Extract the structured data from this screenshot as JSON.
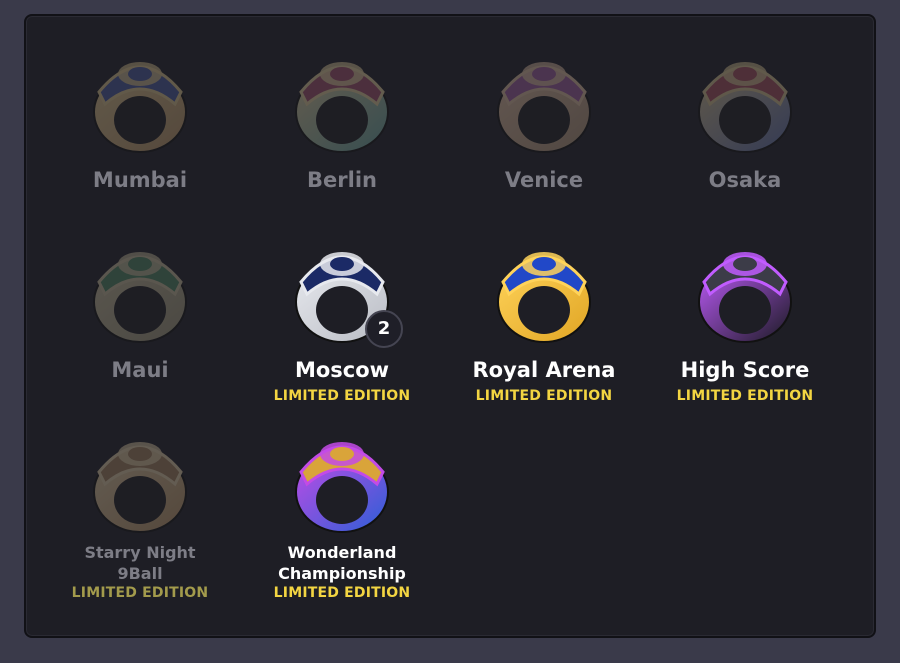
{
  "rings": [
    {
      "id": "mumbai",
      "name": "Mumbai",
      "locked": true,
      "limited": "",
      "badge": "",
      "colors": {
        "band": "#c98a3a",
        "top": "#3b53c8",
        "accent": "#e0b95a"
      }
    },
    {
      "id": "berlin",
      "name": "Berlin",
      "locked": true,
      "limited": "",
      "badge": "",
      "colors": {
        "band": "#3aa7a0",
        "top": "#c63e6b",
        "accent": "#e4c06a"
      }
    },
    {
      "id": "venice",
      "name": "Venice",
      "locked": true,
      "limited": "",
      "badge": "",
      "colors": {
        "band": "#b4875a",
        "top": "#b84ab7",
        "accent": "#e8b07a"
      }
    },
    {
      "id": "osaka",
      "name": "Osaka",
      "locked": true,
      "limited": "",
      "badge": "",
      "colors": {
        "band": "#4a6ad0",
        "top": "#d03e55",
        "accent": "#d9b860"
      }
    },
    {
      "id": "maui",
      "name": "Maui",
      "locked": true,
      "limited": "",
      "badge": "",
      "colors": {
        "band": "#9a8e5e",
        "top": "#2f8a4a",
        "accent": "#c4b278"
      }
    },
    {
      "id": "moscow",
      "name": "Moscow",
      "locked": false,
      "limited": "LIMITED EDITION",
      "badge": "2",
      "colors": {
        "band": "#b9bcc4",
        "top": "#1b2a66",
        "accent": "#e7e9ee"
      }
    },
    {
      "id": "royal-arena",
      "name": "Royal Arena",
      "locked": false,
      "limited": "LIMITED EDITION",
      "badge": "",
      "colors": {
        "band": "#e0a524",
        "top": "#2148c8",
        "accent": "#ffd35a"
      }
    },
    {
      "id": "high-score",
      "name": "High Score",
      "locked": false,
      "limited": "LIMITED EDITION",
      "badge": "",
      "colors": {
        "band": "#1a1a22",
        "top": "#3c3c48",
        "accent": "#c15cff"
      }
    },
    {
      "id": "starry-night",
      "name": "Starry Night\n9Ball",
      "locked": true,
      "limited": "LIMITED EDITION",
      "badge": "",
      "colors": {
        "band": "#c8893a",
        "top": "#b0763a",
        "accent": "#e3c07a"
      }
    },
    {
      "id": "wonderland",
      "name": "Wonderland\nChampionship",
      "locked": false,
      "limited": "LIMITED EDITION",
      "badge": "",
      "colors": {
        "band": "#2b5fd6",
        "top": "#d9a43a",
        "accent": "#c34be6"
      }
    }
  ]
}
